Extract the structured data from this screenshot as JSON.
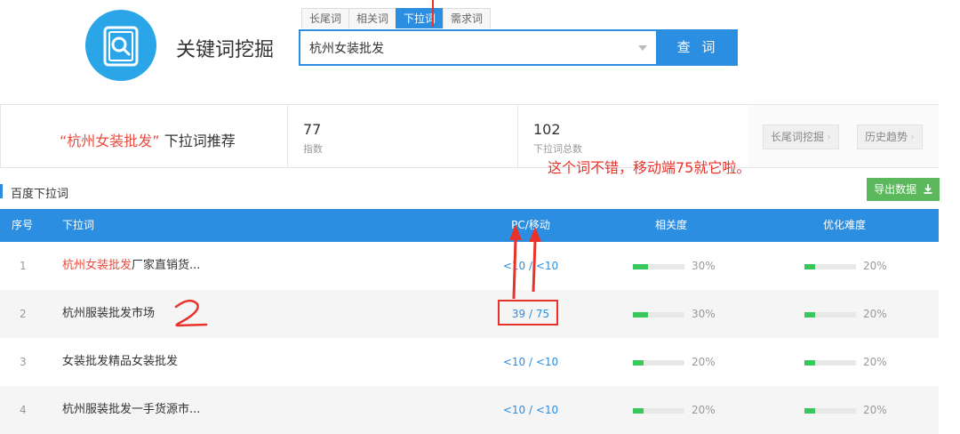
{
  "app": {
    "title": "关键词挖掘"
  },
  "tabs": [
    {
      "label": "长尾词",
      "active": false
    },
    {
      "label": "相关词",
      "active": false
    },
    {
      "label": "下拉词",
      "active": true
    },
    {
      "label": "需求词",
      "active": false
    }
  ],
  "search": {
    "value": "杭州女装批发",
    "button_label": "查 词"
  },
  "summary": {
    "keyword": "“杭州女装批发”",
    "keyword_suffix": "下拉词推荐",
    "index_value": "77",
    "index_label": "指数",
    "total_value": "102",
    "total_label": "下拉词总数",
    "btn_longtail": "长尾词挖掘",
    "btn_history": "历史趋势"
  },
  "annotation": {
    "note": "这个词不错，移动端75就它啦。",
    "number_mark": "2"
  },
  "section": {
    "title": "百度下拉词",
    "export_label": "导出数据"
  },
  "table": {
    "headers": {
      "index": "序号",
      "keyword": "下拉词",
      "pc_mobile": "PC/移动",
      "relevance": "相关度",
      "difficulty": "优化难度"
    },
    "rows": [
      {
        "index": "1",
        "keyword_hl": "杭州女装批发",
        "keyword_rest": "厂家直销货...",
        "pc_mobile": "<10 / <10",
        "relevance": "30%",
        "relevance_value": 0.3,
        "difficulty": "20%",
        "difficulty_value": 0.2
      },
      {
        "index": "2",
        "keyword_hl": "",
        "keyword_rest": "杭州服装批发市场",
        "pc_mobile": "39 / 75",
        "relevance": "30%",
        "relevance_value": 0.3,
        "difficulty": "20%",
        "difficulty_value": 0.2
      },
      {
        "index": "3",
        "keyword_hl": "",
        "keyword_rest": "女装批发精品女装批发",
        "pc_mobile": "<10 / <10",
        "relevance": "20%",
        "relevance_value": 0.2,
        "difficulty": "20%",
        "difficulty_value": 0.2
      },
      {
        "index": "4",
        "keyword_hl": "",
        "keyword_rest": "杭州服装批发一手货源市...",
        "pc_mobile": "<10 / <10",
        "relevance": "20%",
        "relevance_value": 0.2,
        "difficulty": "20%",
        "difficulty_value": 0.2
      }
    ]
  },
  "colors": {
    "accent": "#2c8ee0",
    "highlight": "#e84c3d",
    "annotation": "#e8322a",
    "bar_fill": "#38c75a",
    "export": "#5cb85c"
  },
  "icons": {
    "logo": "document-search-icon",
    "export": "download-icon"
  }
}
